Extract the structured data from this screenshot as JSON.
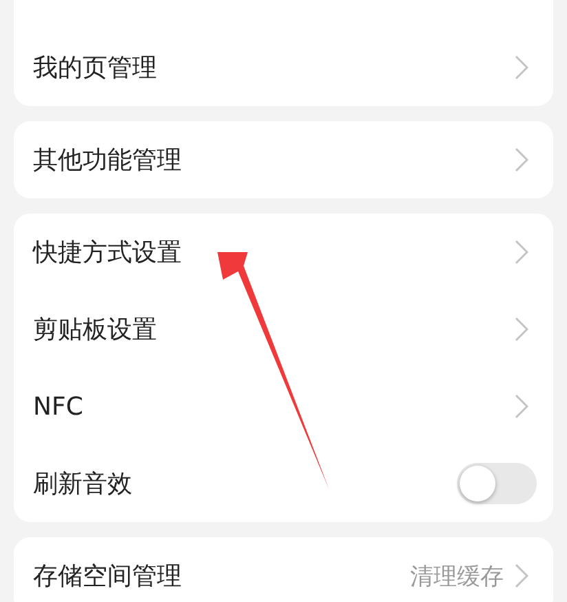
{
  "groups": [
    {
      "rows": [
        {
          "kind": "link",
          "label": "我的页管理"
        }
      ]
    },
    {
      "rows": [
        {
          "kind": "link",
          "label": "其他功能管理"
        }
      ]
    },
    {
      "rows": [
        {
          "kind": "link",
          "label": "快捷方式设置"
        },
        {
          "kind": "link",
          "label": "剪贴板设置"
        },
        {
          "kind": "link",
          "label": "NFC"
        },
        {
          "kind": "toggle",
          "label": "刷新音效",
          "on": false
        }
      ]
    },
    {
      "rows": [
        {
          "kind": "link",
          "label": "存储空间管理",
          "value": "清理缓存"
        }
      ]
    }
  ]
}
